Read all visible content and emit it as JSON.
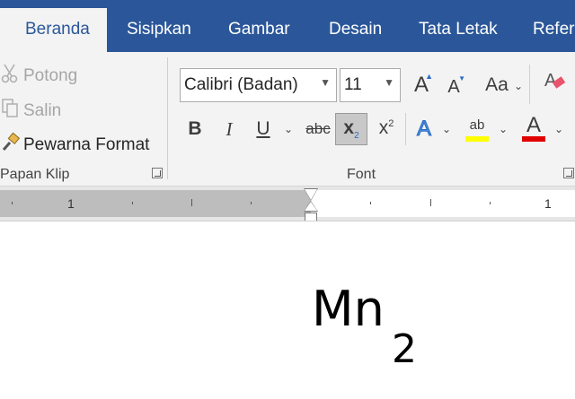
{
  "tabs": [
    "Beranda",
    "Sisipkan",
    "Gambar",
    "Desain",
    "Tata Letak",
    "Refere"
  ],
  "clipboard": {
    "cut": "Potong",
    "copy": "Salin",
    "format_painter": "Pewarna Format",
    "group_label": "Papan Klip"
  },
  "font": {
    "font_name": "Calibri (Badan)",
    "font_size": "11",
    "grow": "A",
    "shrink": "A",
    "case": "Aa",
    "bold": "B",
    "italic": "I",
    "underline": "U",
    "strikethrough": "abc",
    "subscript": "x",
    "subscript_mark": "2",
    "superscript": "x",
    "superscript_mark": "2",
    "text_effects": "A",
    "highlight": "ab",
    "font_color": "A",
    "group_label": "Font",
    "highlight_color": "#ffff00",
    "font_color_value": "#e00000"
  },
  "ruler": {
    "left_number": "1",
    "right_number": "1"
  },
  "document": {
    "text_main": "Mn",
    "text_subscript": "2"
  },
  "colors": {
    "ribbon_tab_bar": "#2b579a",
    "ribbon_bg": "#f3f3f3"
  }
}
